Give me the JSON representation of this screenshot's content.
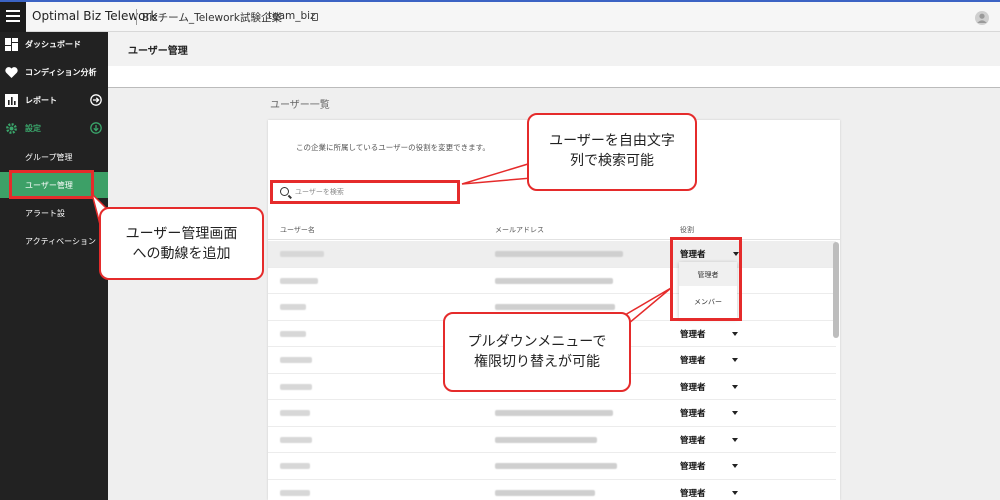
{
  "topbar": {
    "app_title": "Optimal Biz Telework",
    "org_name": "Bizチーム_Telework試験企業",
    "team_name": "team_biz"
  },
  "sidebar": {
    "items": [
      {
        "label": "ダッシュボード",
        "icon": "dashboard-icon"
      },
      {
        "label": "コンディション分析",
        "icon": "heart-icon"
      },
      {
        "label": "レポート",
        "icon": "bar-chart-icon"
      },
      {
        "label": "設定",
        "icon": "gear-icon"
      }
    ],
    "sub_items": [
      {
        "label": "グループ管理"
      },
      {
        "label": "ユーザー管理"
      },
      {
        "label": "アラート設"
      },
      {
        "label": "アクティベーション"
      }
    ]
  },
  "page": {
    "title": "ユーザー管理",
    "section_title": "ユーザー一覧",
    "description": "この企業に所属しているユーザーの役割を変更できます。",
    "search_placeholder": "ユーザーを検索"
  },
  "table": {
    "headers": {
      "name": "ユーザー名",
      "email": "メールアドレス",
      "role": "役割"
    },
    "rows": [
      {
        "role": "管理者"
      },
      {
        "role": ""
      },
      {
        "role": ""
      },
      {
        "role": "管理者"
      },
      {
        "role": "管理者"
      },
      {
        "role": "管理者"
      },
      {
        "role": "管理者"
      },
      {
        "role": "管理者"
      },
      {
        "role": "管理者"
      },
      {
        "role": "管理者"
      }
    ]
  },
  "dropdown": {
    "options": [
      "管理者",
      "メンバー"
    ]
  },
  "callouts": {
    "search": "ユーザーを自由文字\n列で検索可能",
    "sidebar": "ユーザー管理画面\nへの動線を追加",
    "dropdown": "プルダウンメニューで\n権限切り替えが可能"
  },
  "colors": {
    "accent_green": "#3da067",
    "highlight_red": "#e52b2b",
    "topbar_blue": "#3b63c4"
  }
}
